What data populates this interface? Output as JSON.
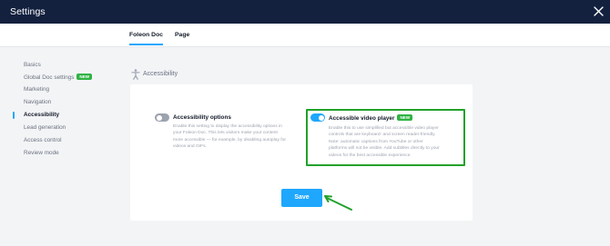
{
  "header": {
    "title": "Settings",
    "close_icon": "close-icon"
  },
  "tabs": [
    {
      "label": "Foleon Doc",
      "active": true
    },
    {
      "label": "Page",
      "active": false
    }
  ],
  "sidebar": {
    "items": [
      {
        "label": "Basics",
        "active": false
      },
      {
        "label": "Global Doc settings",
        "active": false,
        "badge": "NEW"
      },
      {
        "label": "Marketing",
        "active": false
      },
      {
        "label": "Navigation",
        "active": false
      },
      {
        "label": "Accessibility",
        "active": true
      },
      {
        "label": "Lead generation",
        "active": false
      },
      {
        "label": "Access control",
        "active": false
      },
      {
        "label": "Review mode",
        "active": false
      }
    ]
  },
  "section": {
    "title": "Accessibility",
    "icon": "accessibility-person-icon"
  },
  "options": [
    {
      "title": "Accessibility options",
      "enabled": false,
      "description_lines": [
        "Enable this setting to display the accessibility options in",
        "your Foleon Doc. This lets visitors make your content",
        "more accessible — for example, by disabling autoplay for",
        "videos and GIFs."
      ]
    },
    {
      "title": "Accessible video player",
      "enabled": true,
      "badge": "NEW",
      "description_lines": [
        "Enable this to use simplified but accessible video player",
        "controls that are keyboard- and screen reader-friendly.",
        "Note: automatic captions from YouTube or other",
        "platforms will not be visible. Add subtitles directly to your",
        "videos for the best accessible experience."
      ]
    }
  ],
  "save_button": {
    "label": "Save"
  },
  "colors": {
    "header_bg": "#13213f",
    "accent": "#1ea7fd",
    "badge": "#2fb344",
    "highlight": "#22a12a"
  }
}
